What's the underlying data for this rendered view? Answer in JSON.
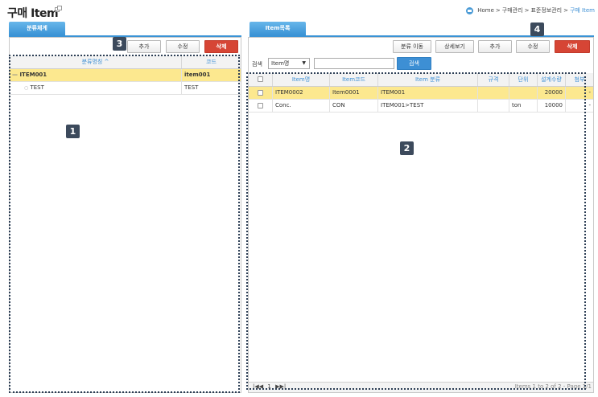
{
  "header": {
    "title": "구매 Item",
    "breadcrumb": [
      "Home",
      "구매관리",
      "표준정보관리",
      "구매 Item"
    ],
    "breadcrumb_sep": ">"
  },
  "left_panel": {
    "tab_label": "분류체계",
    "buttons": {
      "add": "추가",
      "edit": "수정",
      "delete": "삭제"
    },
    "columns": {
      "name": "분류명칭 ^",
      "code": "코드"
    },
    "tree": [
      {
        "name": "ITEM001",
        "code": "item001",
        "selected": true,
        "prefix": "—"
      },
      {
        "name": "TEST",
        "code": "TEST",
        "selected": false,
        "prefix": "○"
      }
    ]
  },
  "right_panel": {
    "tab_label": "Item목록",
    "buttons": {
      "move": "분류 이동",
      "detail": "상세보기",
      "add": "추가",
      "edit": "수정",
      "delete": "삭제"
    },
    "search": {
      "label": "검색",
      "field": "Item명",
      "value": "",
      "button": "검색"
    },
    "columns": [
      "Item명",
      "Item코드",
      "Item 분류",
      "규격",
      "단위",
      "설계수량",
      "첨부"
    ],
    "rows": [
      {
        "name": "ITEM0002",
        "code": "Item0001",
        "category": "ITEM001",
        "spec": "",
        "unit": "",
        "qty": "20000",
        "attach": "-",
        "selected": true
      },
      {
        "name": "Conc.",
        "code": "CON",
        "category": "ITEM001>TEST",
        "spec": "",
        "unit": "ton",
        "qty": "10000",
        "attach": "-",
        "selected": false
      }
    ],
    "pager": {
      "first": "|◀◀",
      "page": "1",
      "last": "▶▶|",
      "summary": "Items 1 to 2 of 2 - Page 1/1"
    }
  },
  "callouts": [
    "1",
    "2",
    "3",
    "4"
  ],
  "colors": {
    "accent": "#3a93d5",
    "danger": "#d64535",
    "selected_row": "#fce88f",
    "callout": "#3c4a5c"
  }
}
